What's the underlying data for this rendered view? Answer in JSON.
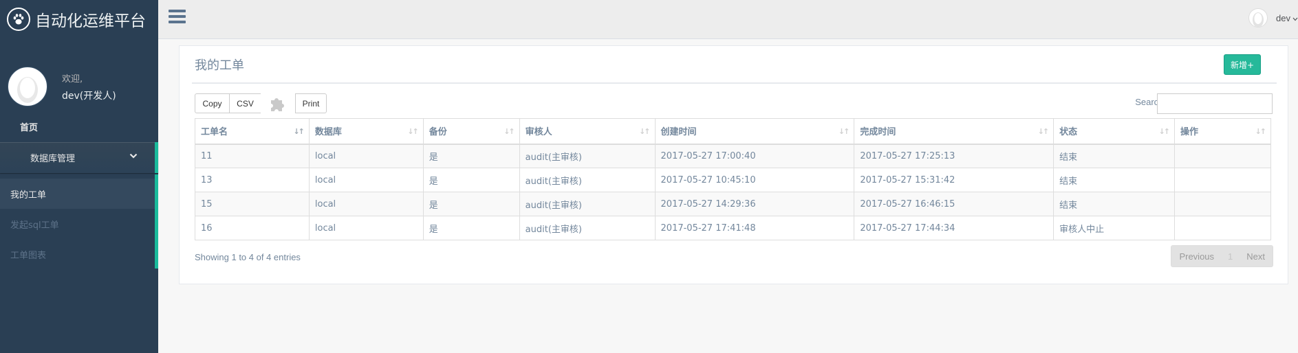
{
  "brand": {
    "title": "自动化运维平台",
    "icon": "paw-icon"
  },
  "profile": {
    "welcome": "欢迎,",
    "name": "dev(开发人)"
  },
  "sidebar": {
    "home": "首页",
    "db_manage": "数据库管理",
    "submenu": [
      "我的工单",
      "发起sql工单",
      "工单图表"
    ]
  },
  "topbar": {
    "user": "dev"
  },
  "panel": {
    "title": "我的工单",
    "add_button": "新增+",
    "buttons": {
      "copy": "Copy",
      "csv": "CSV",
      "print": "Print"
    },
    "search_label": "Search:",
    "search_value": "",
    "columns": [
      "工单名",
      "数据库",
      "备份",
      "审核人",
      "创建时间",
      "完成时间",
      "状态",
      "操作"
    ],
    "rows": [
      [
        "11",
        "local",
        "是",
        "audit(主审核)",
        "2017-05-27 17:00:40",
        "2017-05-27 17:25:13",
        "结束",
        ""
      ],
      [
        "13",
        "local",
        "是",
        "audit(主审核)",
        "2017-05-27 10:45:10",
        "2017-05-27 15:31:42",
        "结束",
        ""
      ],
      [
        "15",
        "local",
        "是",
        "audit(主审核)",
        "2017-05-27 14:29:36",
        "2017-05-27 16:46:15",
        "结束",
        ""
      ],
      [
        "16",
        "local",
        "是",
        "audit(主审核)",
        "2017-05-27 17:41:48",
        "2017-05-27 17:44:34",
        "审核人中止",
        ""
      ]
    ],
    "info": "Showing 1 to 4 of 4 entries",
    "pager": {
      "prev": "Previous",
      "current": "1",
      "next": "Next"
    }
  },
  "colors": {
    "sidebar": "#2a3f54",
    "accent": "#1abb9c",
    "add_button": "#26b99a",
    "text": "#73879c"
  }
}
